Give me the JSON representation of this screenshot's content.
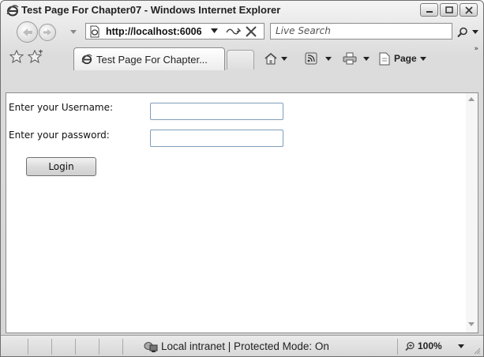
{
  "window": {
    "title": "Test Page For Chapter07 - Windows Internet Explorer"
  },
  "address_bar": {
    "url": "http://localhost:6006"
  },
  "search": {
    "placeholder": "Live Search"
  },
  "tabs": [
    {
      "label": "Test Page For Chapter...",
      "active": true
    }
  ],
  "command_bar": {
    "page_label": "Page"
  },
  "form": {
    "username_label": "Enter your Username:",
    "password_label": "Enter your password:",
    "username_value": "",
    "password_value": "",
    "login_label": "Login"
  },
  "status_bar": {
    "zone_text": "Local intranet | Protected Mode: On",
    "zoom": "100%"
  },
  "icons": [
    "ie-logo-icon",
    "minimize-icon",
    "maximize-icon",
    "close-icon",
    "back-icon",
    "forward-icon",
    "page-icon",
    "refresh-icon",
    "stop-icon",
    "search-icon",
    "favorites-star-icon",
    "add-favorites-icon",
    "tab-ie-icon",
    "home-icon",
    "feeds-icon",
    "print-icon",
    "page-menu-icon",
    "zone-icon",
    "zoom-icon"
  ]
}
